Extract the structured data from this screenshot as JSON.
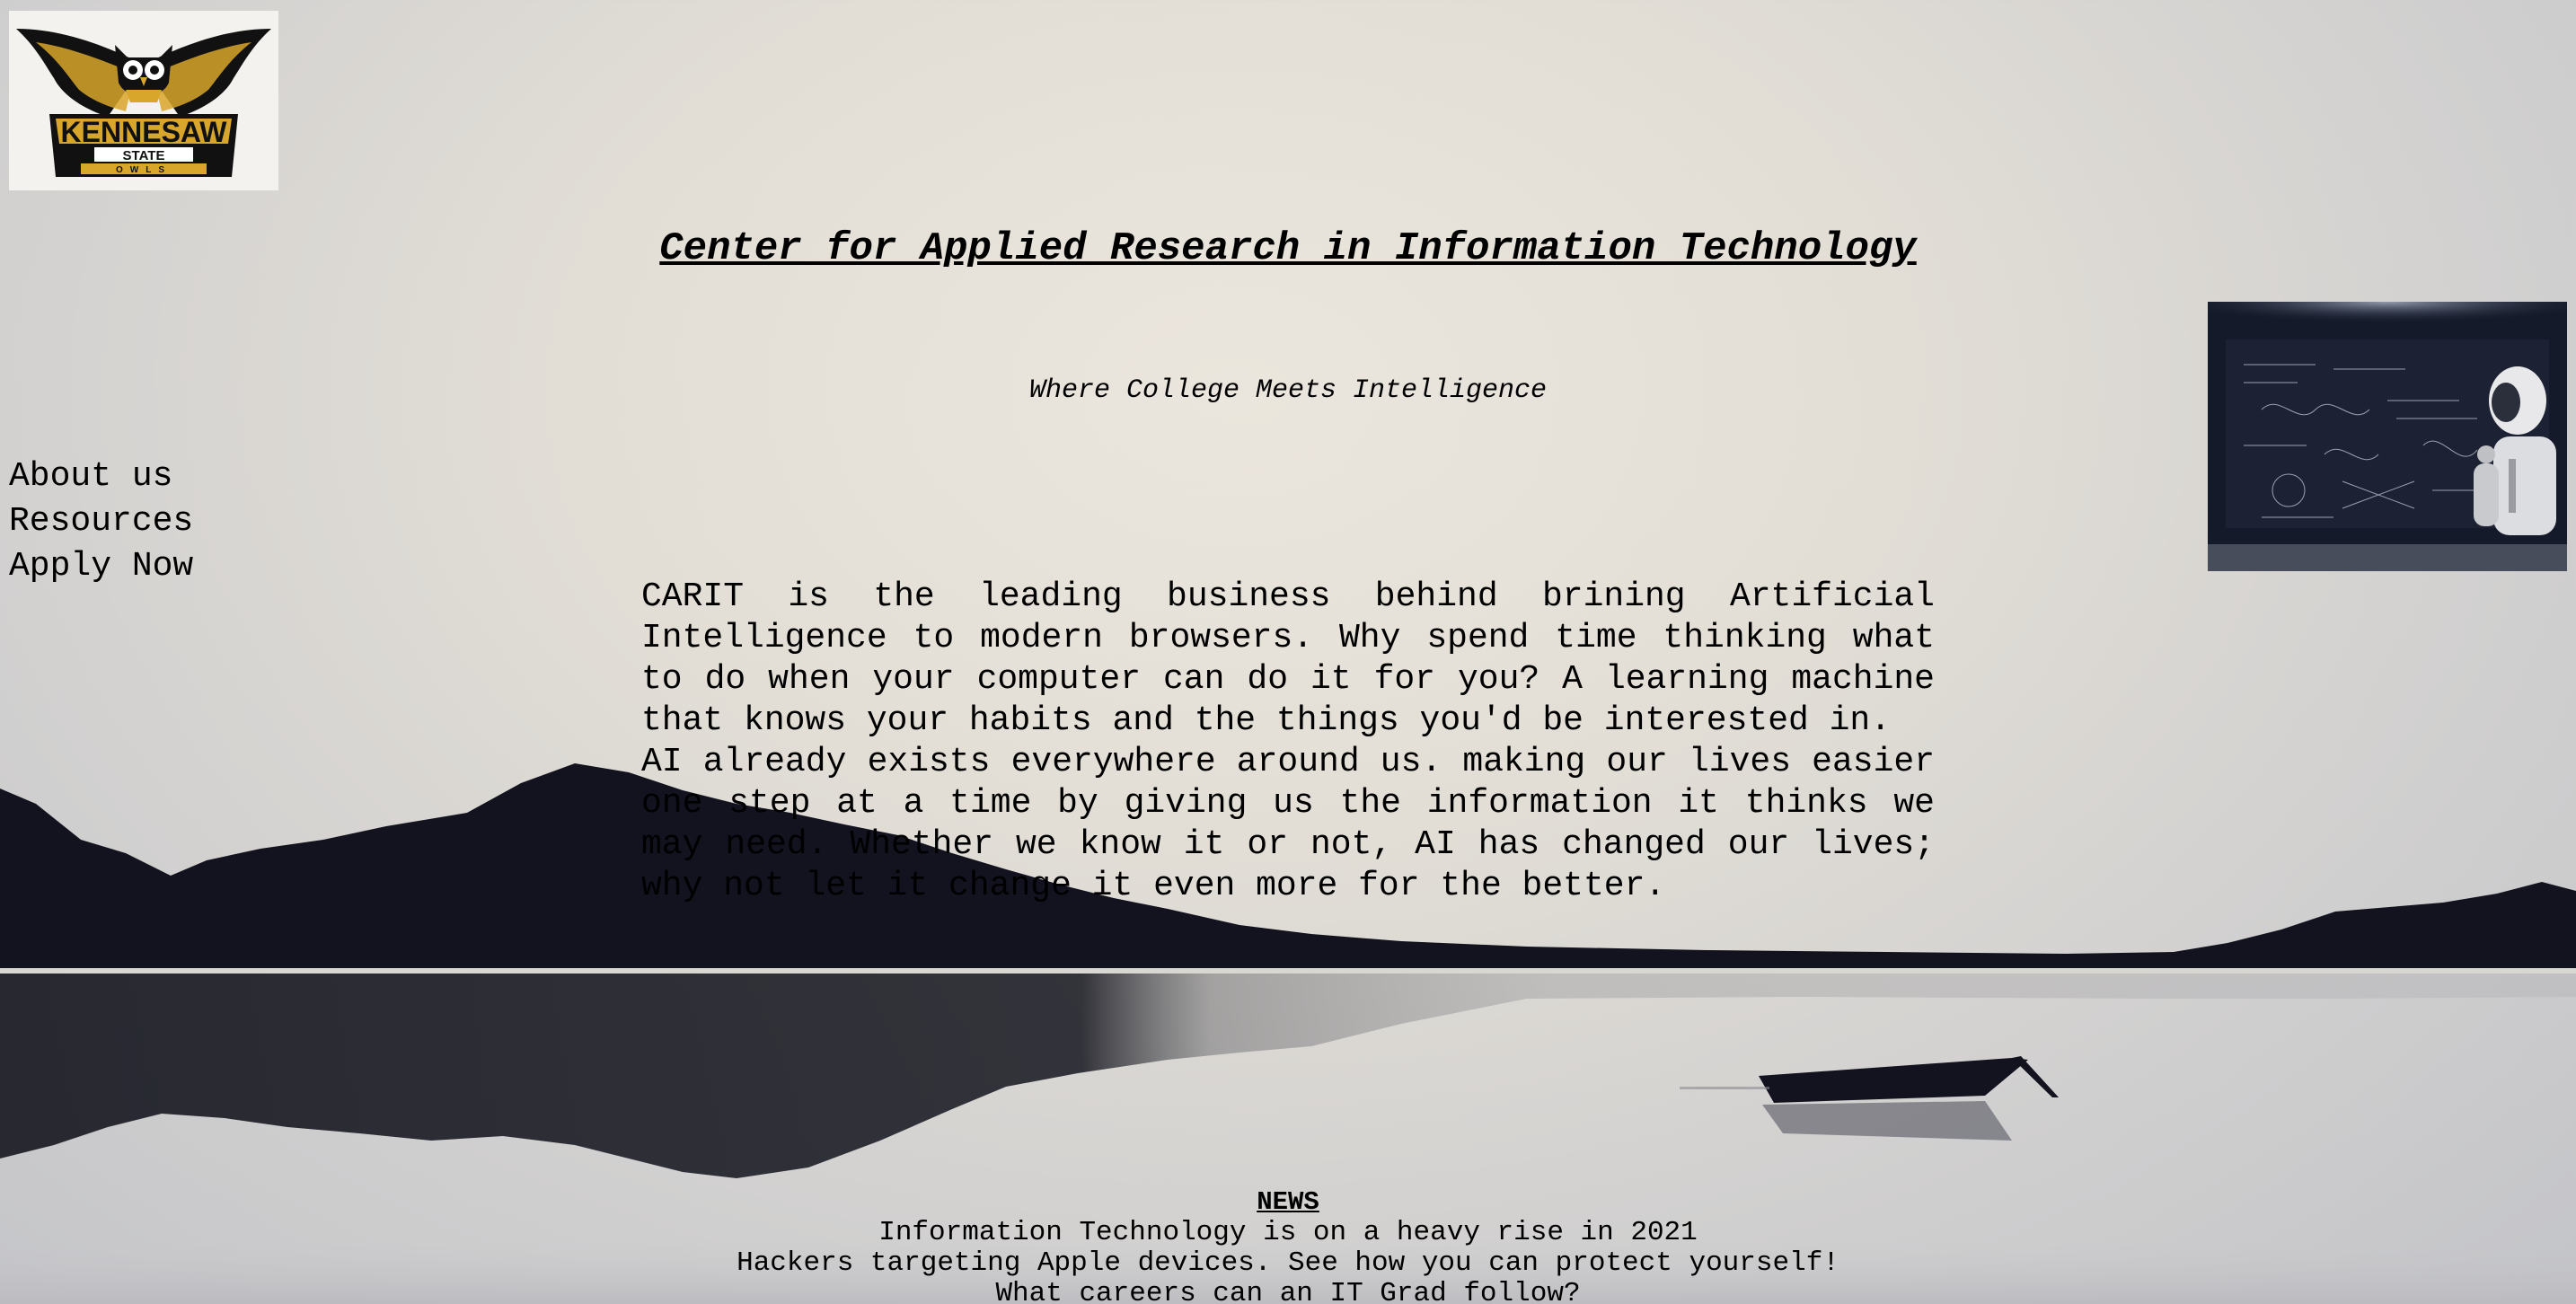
{
  "header": {
    "logo": {
      "icon": "kennesaw-state-owls-logo",
      "text_lines": [
        "KENNESAW",
        "STATE",
        "OWLS"
      ],
      "colors": {
        "black": "#111111",
        "gold": "#d8a62a",
        "white": "#ffffff"
      }
    },
    "title": "Center for Applied Research in Information Technology",
    "tagline": "Where College Meets Intelligence"
  },
  "nav": {
    "items": [
      {
        "label": "About us"
      },
      {
        "label": "Resources"
      },
      {
        "label": "Apply Now"
      }
    ]
  },
  "main": {
    "paragraphs": [
      "CARIT is the leading business behind brining Artificial Intelligence to modern browsers. Why spend time thinking what to do when your computer can do it for you? A learning machine that knows your habits and the things you'd be interested in.",
      "AI already exists everywhere around us. making our lives easier one step at a time by giving us the information it thinks we may need. Whether we know it or not, AI has changed our lives; why not let it change it even more for the better."
    ]
  },
  "news": {
    "title": "NEWS",
    "items": [
      "Information Technology is on a heavy rise in 2021",
      "Hackers targeting Apple devices. See how you can protect yourself!",
      "What careers can an IT Grad follow?"
    ]
  },
  "images": {
    "robot": {
      "icon": "robot-chalkboard-image"
    }
  },
  "theme": {
    "background_light": "#e6e2da",
    "silhouette": "#12131f"
  }
}
